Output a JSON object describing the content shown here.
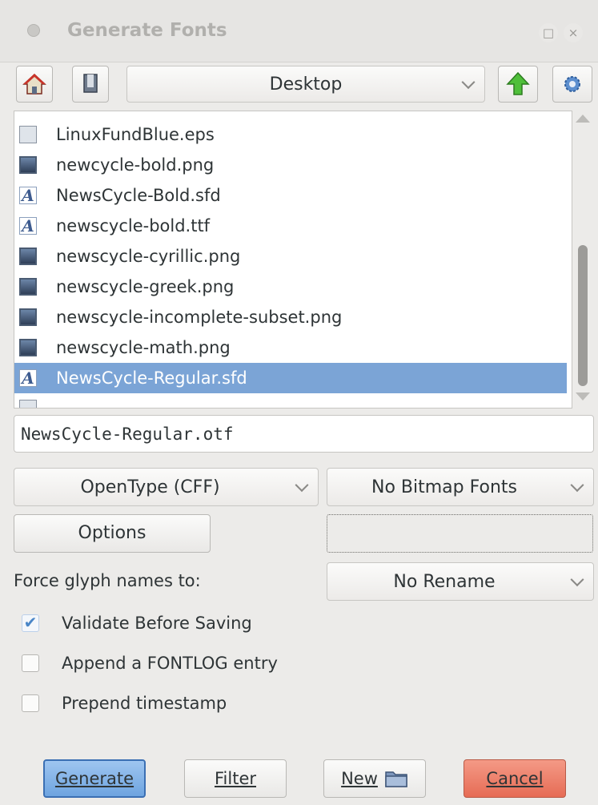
{
  "window": {
    "title": "Generate Fonts",
    "controls": [
      "□",
      "×"
    ]
  },
  "toolbar": {
    "home_icon": "home-icon",
    "bookmark_icon": "bookmark-icon",
    "location": "Desktop",
    "up_icon": "up-arrow-icon",
    "settings_icon": "gear-icon"
  },
  "files": [
    {
      "name": "LinuxFundBlue.eps",
      "icon": "eps-file-icon"
    },
    {
      "name": "newcycle-bold.png",
      "icon": "image-file-icon"
    },
    {
      "name": "NewsCycle-Bold.sfd",
      "icon": "font-file-icon"
    },
    {
      "name": "newscycle-bold.ttf",
      "icon": "font-file-icon"
    },
    {
      "name": "newscycle-cyrillic.png",
      "icon": "image-file-icon"
    },
    {
      "name": "newscycle-greek.png",
      "icon": "image-file-icon"
    },
    {
      "name": "newscycle-incomplete-subset.png",
      "icon": "image-file-icon"
    },
    {
      "name": "newscycle-math.png",
      "icon": "image-file-icon"
    },
    {
      "name": "NewsCycle-Regular.sfd",
      "icon": "font-file-icon",
      "selected": true
    }
  ],
  "filename": "NewsCycle-Regular.otf",
  "format": {
    "outline": "OpenType (CFF)",
    "bitmap": "No Bitmap Fonts"
  },
  "options_button": "Options",
  "force_glyph": {
    "label": "Force glyph names to:",
    "value": "No Rename"
  },
  "checks": [
    {
      "label": "Validate Before Saving",
      "checked": true
    },
    {
      "label": "Append a FONTLOG entry",
      "checked": false
    },
    {
      "label": "Prepend timestamp",
      "checked": false
    }
  ],
  "buttons": {
    "generate": "Generate",
    "filter": "Filter",
    "new": "New",
    "cancel": "Cancel"
  },
  "colors": {
    "selection": "#7ba4d6",
    "accent": "#6ea4e0",
    "cancel": "#e66c55"
  }
}
